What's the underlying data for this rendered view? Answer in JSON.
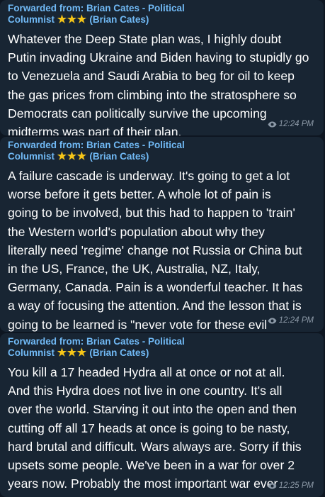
{
  "messages": [
    {
      "forward_prefix": "Forwarded from: Brian Cates - Political",
      "forward_line2_start": "Columnist",
      "stars": "★★★",
      "forward_line2_end": "(Brian Cates)",
      "text": "Whatever the Deep State plan was, I highly doubt\nPutin invading Ukraine and Biden having to stupidly go\nto Venezuela and Saudi Arabia to beg for oil to keep\nthe gas prices from climbing into the stratosphere so\nDemocrats can politically survive the upcoming\nmidterms was part of their plan.",
      "time": "12:24 PM",
      "views_icon": "eye-icon"
    },
    {
      "forward_prefix": "Forwarded from: Brian Cates - Political",
      "forward_line2_start": "Columnist",
      "stars": "★★★",
      "forward_line2_end": "(Brian Cates)",
      "text": "A failure cascade is underway.  It's going to get a lot\nworse before it gets better.  A whole lot of pain is\ngoing to be involved, but this had to happen to 'train'\nthe Western world's population about why they\nliterally need 'regime' change not Russia or China but\nin the US, France, the UK, Australia, NZ, Italy,\nGermany, Canada.  Pain is a wonderful teacher.  It has\na way of focusing the attention. And the lesson that is\ngoing to be learned is \"never vote for these evil\npeople again.\"",
      "time": "12:24 PM",
      "views_icon": "eye-icon"
    },
    {
      "forward_prefix": "Forwarded from: Brian Cates - Political",
      "forward_line2_start": "Columnist",
      "stars": "★★★",
      "forward_line2_end": "(Brian Cates)",
      "text": "You kill a 17 headed Hydra all at once or not at all.\nAnd this Hydra does not live in one country.  It's all\nover the world.  Starving it out into the open and then\ncutting off all 17 heads at once is going to be nasty,\nhard brutal and difficult. Wars always are.  Sorry if this\nupsets some people. We've been in a war for over 2\nyears now.  Probably the most important war ever\nfought in the history of the world.",
      "time": "12:25 PM",
      "views_icon": "eye-icon"
    }
  ],
  "colors": {
    "background": "#0e1621",
    "bubble": "#182533",
    "forward_link": "#71baf6",
    "stars": "#f5c518",
    "text": "#ffffff",
    "meta": "#8d9aa8"
  }
}
